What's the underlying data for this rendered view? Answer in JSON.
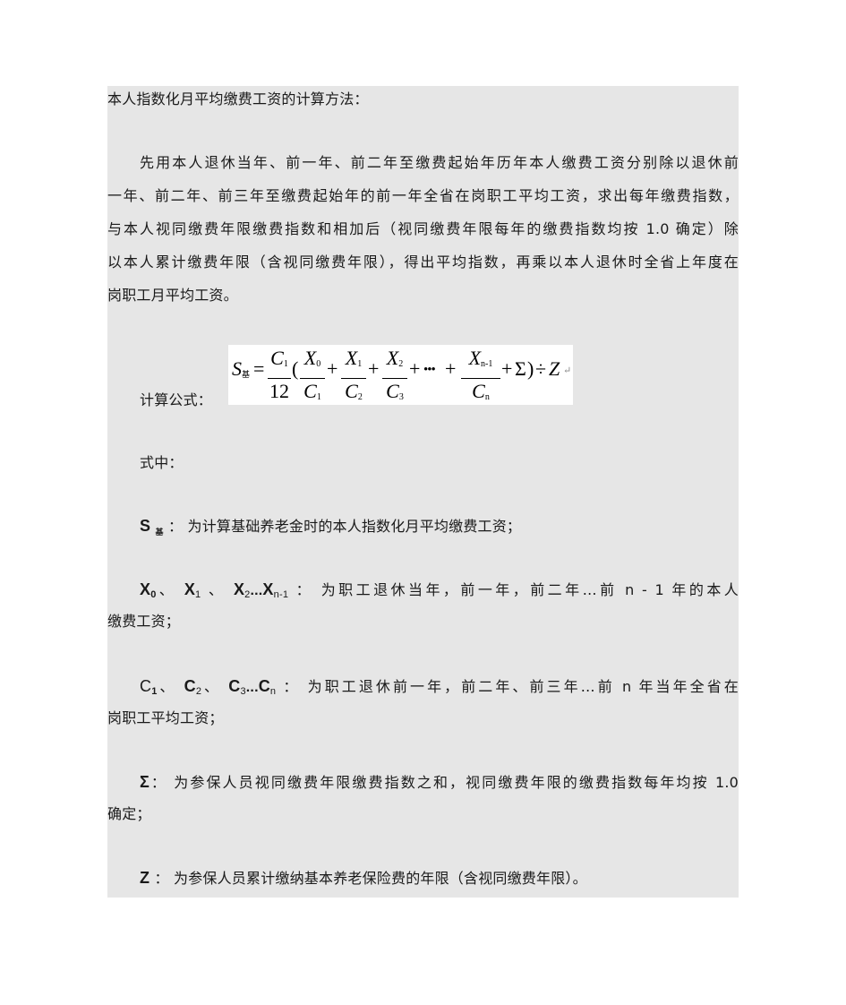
{
  "document": {
    "heading": "本人指数化月平均缴费工资的计算方法：",
    "paragraph_lines": [
      "先用本人退休当年、前一年、前二年至缴费起始年历年本人缴费工资分别除以退休前",
      "一年、前二年、前三年至缴费起始年的前一年全省在岗职工平均工资，求出每年缴费指数，",
      "与本人视同缴费年限缴费指数和相加后（视同缴费年限每年的缴费指数均按 1.0 确定）除",
      "以本人累计缴费年限（含视同缴费年限），得出平均指数，再乘以本人退休时全省上年度在",
      "岗职工月平均工资。"
    ],
    "formula_label": "计算公式：",
    "formula": {
      "lhs": "S",
      "lhs_sub": "基",
      "eq": "=",
      "coef_num": "C",
      "coef_num_sub": "1",
      "coef_den": "12",
      "open_paren": "(",
      "terms": [
        {
          "num": "X",
          "num_sub": "0",
          "den": "C",
          "den_sub": "1"
        },
        {
          "num": "X",
          "num_sub": "1",
          "den": "C",
          "den_sub": "2"
        },
        {
          "num": "X",
          "num_sub": "2",
          "den": "C",
          "den_sub": "3"
        },
        {
          "num": "X",
          "num_sub": "n-1",
          "den": "C",
          "den_sub": "n"
        }
      ],
      "plus": "+",
      "ellipsis": "•••",
      "sigma": "Σ",
      "close_paren": ")",
      "divide": "÷",
      "z": "Z",
      "return_mark": "↵"
    },
    "where_label": "式中：",
    "definitions": {
      "s": {
        "symbol": "S",
        "sub": "基",
        "sep": " ：",
        "text": "为计算基础养老金时的本人指数化月平均缴费工资；"
      },
      "x": {
        "items": [
          {
            "symbol": "X",
            "sub": "0",
            "sep": "、 "
          },
          {
            "symbol": "X",
            "sub": "1",
            "sep": " 、 "
          },
          {
            "symbol": "X",
            "sub": "2",
            "sep": ""
          },
          {
            "symbol": "X",
            "sub": "n-1",
            "sep": ""
          }
        ],
        "dots": "...",
        "colon": " ：",
        "text_line1": "为职工退休当年，前一年，前二年…前  n -  1 年的本人",
        "text_line2": "缴费工资；"
      },
      "c": {
        "items": [
          {
            "symbol": "C",
            "sub": "1",
            "sep": "、 "
          },
          {
            "symbol": "C",
            "sub": "2",
            "sep": "、 "
          },
          {
            "symbol": "C",
            "sub": "3",
            "sep": ""
          },
          {
            "symbol": "C",
            "sub": "n",
            "sep": ""
          }
        ],
        "dots": "...",
        "colon": " ：",
        "text_line1": "为职工退休前一年，前二年、前三年…前  n 年当年全省在",
        "text_line2": "岗职工平均工资；"
      },
      "sigma": {
        "symbol": "Σ",
        "sep": "：",
        "text_line1": "为参保人员视同缴费年限缴费指数之和，视同缴费年限的缴费指数每年均按  1.0",
        "text_line2": "确定；"
      },
      "z": {
        "symbol": "Z",
        "sep": " ：",
        "text": "为参保人员累计缴纳基本养老保险费的年限（含视同缴费年限）。"
      }
    }
  }
}
